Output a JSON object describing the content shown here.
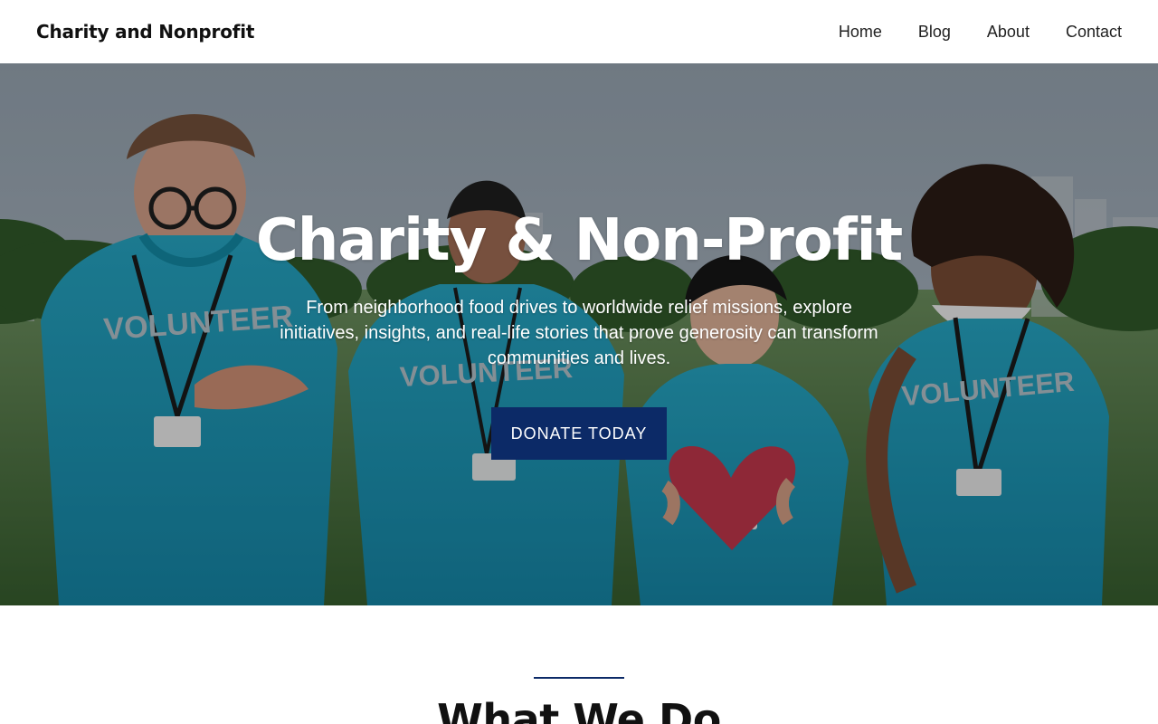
{
  "header": {
    "site_title": "Charity and Nonprofit",
    "nav": [
      "Home",
      "Blog",
      "About",
      "Contact"
    ]
  },
  "hero": {
    "title": "Charity & Non-Profit",
    "text": "From neighborhood food drives to worldwide relief missions, explore initiatives, insights, and real-life stories that prove generosity can transform communities and lives.",
    "button_label": "DONATE TODAY",
    "image_subject": "volunteers-with-heart",
    "shirt_text": "VOLUNTEER"
  },
  "section": {
    "title": "What We Do"
  },
  "colors": {
    "accent": "#0c2a67",
    "volunteer_shirt": "#1d9fc0",
    "heart": "#c5384d"
  }
}
